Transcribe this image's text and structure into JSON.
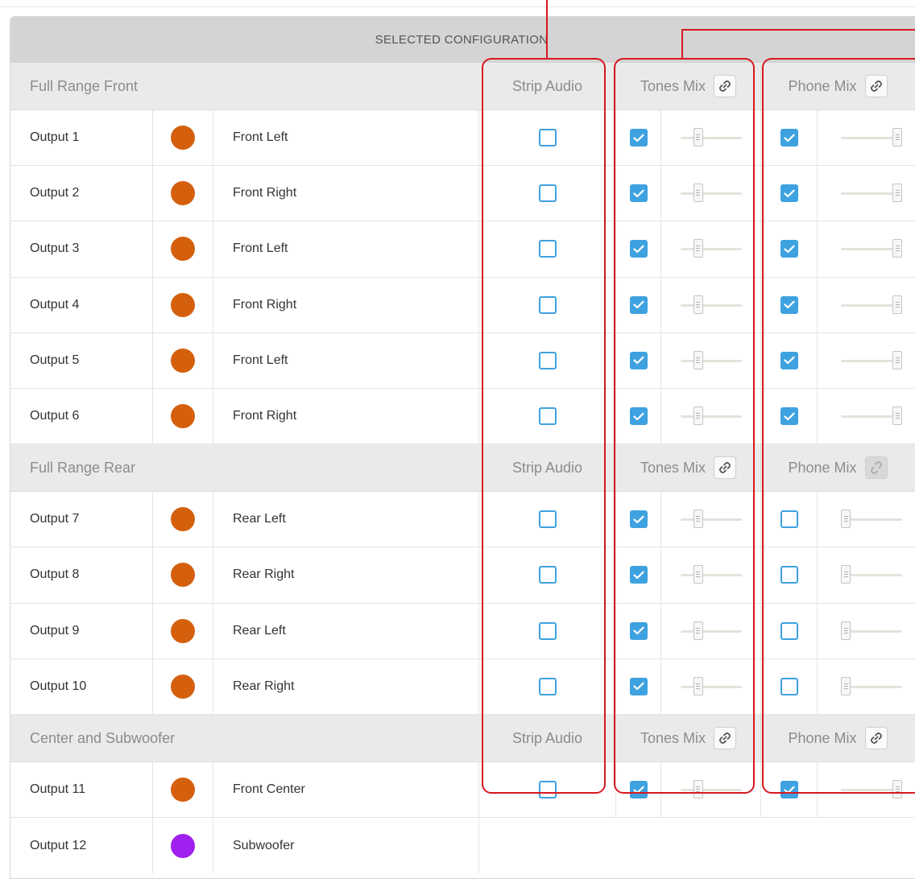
{
  "header": {
    "title": "SELECTED CONFIGURATION"
  },
  "columns": {
    "strip": "Strip Audio",
    "tones": "Tones Mix",
    "phone": "Phone Mix"
  },
  "colors": {
    "accent": "#3fa2e0",
    "full_range": "#d4600e",
    "subwoofer": "#a020f0",
    "highlight": "#d7181f"
  },
  "rows": [
    {
      "type": "group",
      "title": "Full Range Front",
      "strip": "Strip Audio",
      "tones": "Tones Mix",
      "phone": "Phone Mix",
      "tones_link": "linked",
      "phone_link": "linked"
    },
    {
      "type": "output",
      "name": "Output 1",
      "label": "Front Left",
      "color": "#d4600e",
      "strip": false,
      "tones_on": true,
      "tones_level": 0.25,
      "phone_on": true,
      "phone_level": 1.0
    },
    {
      "type": "output",
      "name": "Output 2",
      "label": "Front Right",
      "color": "#d4600e",
      "strip": false,
      "tones_on": true,
      "tones_level": 0.25,
      "phone_on": true,
      "phone_level": 1.0
    },
    {
      "type": "output",
      "name": "Output 3",
      "label": "Front Left",
      "color": "#d4600e",
      "strip": false,
      "tones_on": true,
      "tones_level": 0.25,
      "phone_on": true,
      "phone_level": 1.0
    },
    {
      "type": "output",
      "name": "Output 4",
      "label": "Front Right",
      "color": "#d4600e",
      "strip": false,
      "tones_on": true,
      "tones_level": 0.25,
      "phone_on": true,
      "phone_level": 1.0
    },
    {
      "type": "output",
      "name": "Output 5",
      "label": "Front Left",
      "color": "#d4600e",
      "strip": false,
      "tones_on": true,
      "tones_level": 0.25,
      "phone_on": true,
      "phone_level": 1.0
    },
    {
      "type": "output",
      "name": "Output 6",
      "label": "Front Right",
      "color": "#d4600e",
      "strip": false,
      "tones_on": true,
      "tones_level": 0.25,
      "phone_on": true,
      "phone_level": 1.0
    },
    {
      "type": "group",
      "title": "Full Range Rear",
      "strip": "Strip Audio",
      "tones": "Tones Mix",
      "phone": "Phone Mix",
      "tones_link": "linked",
      "phone_link": "unlinked"
    },
    {
      "type": "output",
      "name": "Output 7",
      "label": "Rear Left",
      "color": "#d4600e",
      "strip": false,
      "tones_on": true,
      "tones_level": 0.25,
      "phone_on": false,
      "phone_level": 0.0
    },
    {
      "type": "output",
      "name": "Output 8",
      "label": "Rear Right",
      "color": "#d4600e",
      "strip": false,
      "tones_on": true,
      "tones_level": 0.25,
      "phone_on": false,
      "phone_level": 0.0
    },
    {
      "type": "output",
      "name": "Output 9",
      "label": "Rear Left",
      "color": "#d4600e",
      "strip": false,
      "tones_on": true,
      "tones_level": 0.25,
      "phone_on": false,
      "phone_level": 0.0
    },
    {
      "type": "output",
      "name": "Output 10",
      "label": "Rear Right",
      "color": "#d4600e",
      "strip": false,
      "tones_on": true,
      "tones_level": 0.25,
      "phone_on": false,
      "phone_level": 0.0
    },
    {
      "type": "group",
      "title": "Center and Subwoofer",
      "strip": "Strip Audio",
      "tones": "Tones Mix",
      "phone": "Phone Mix",
      "tones_link": "linked",
      "phone_link": "linked"
    },
    {
      "type": "output",
      "name": "Output 11",
      "label": "Front Center",
      "color": "#d4600e",
      "strip": false,
      "tones_on": true,
      "tones_level": 0.25,
      "phone_on": true,
      "phone_level": 1.0
    },
    {
      "type": "output",
      "name": "Output 12",
      "label": "Subwoofer",
      "color": "#a020f0",
      "no_mix": true
    }
  ]
}
